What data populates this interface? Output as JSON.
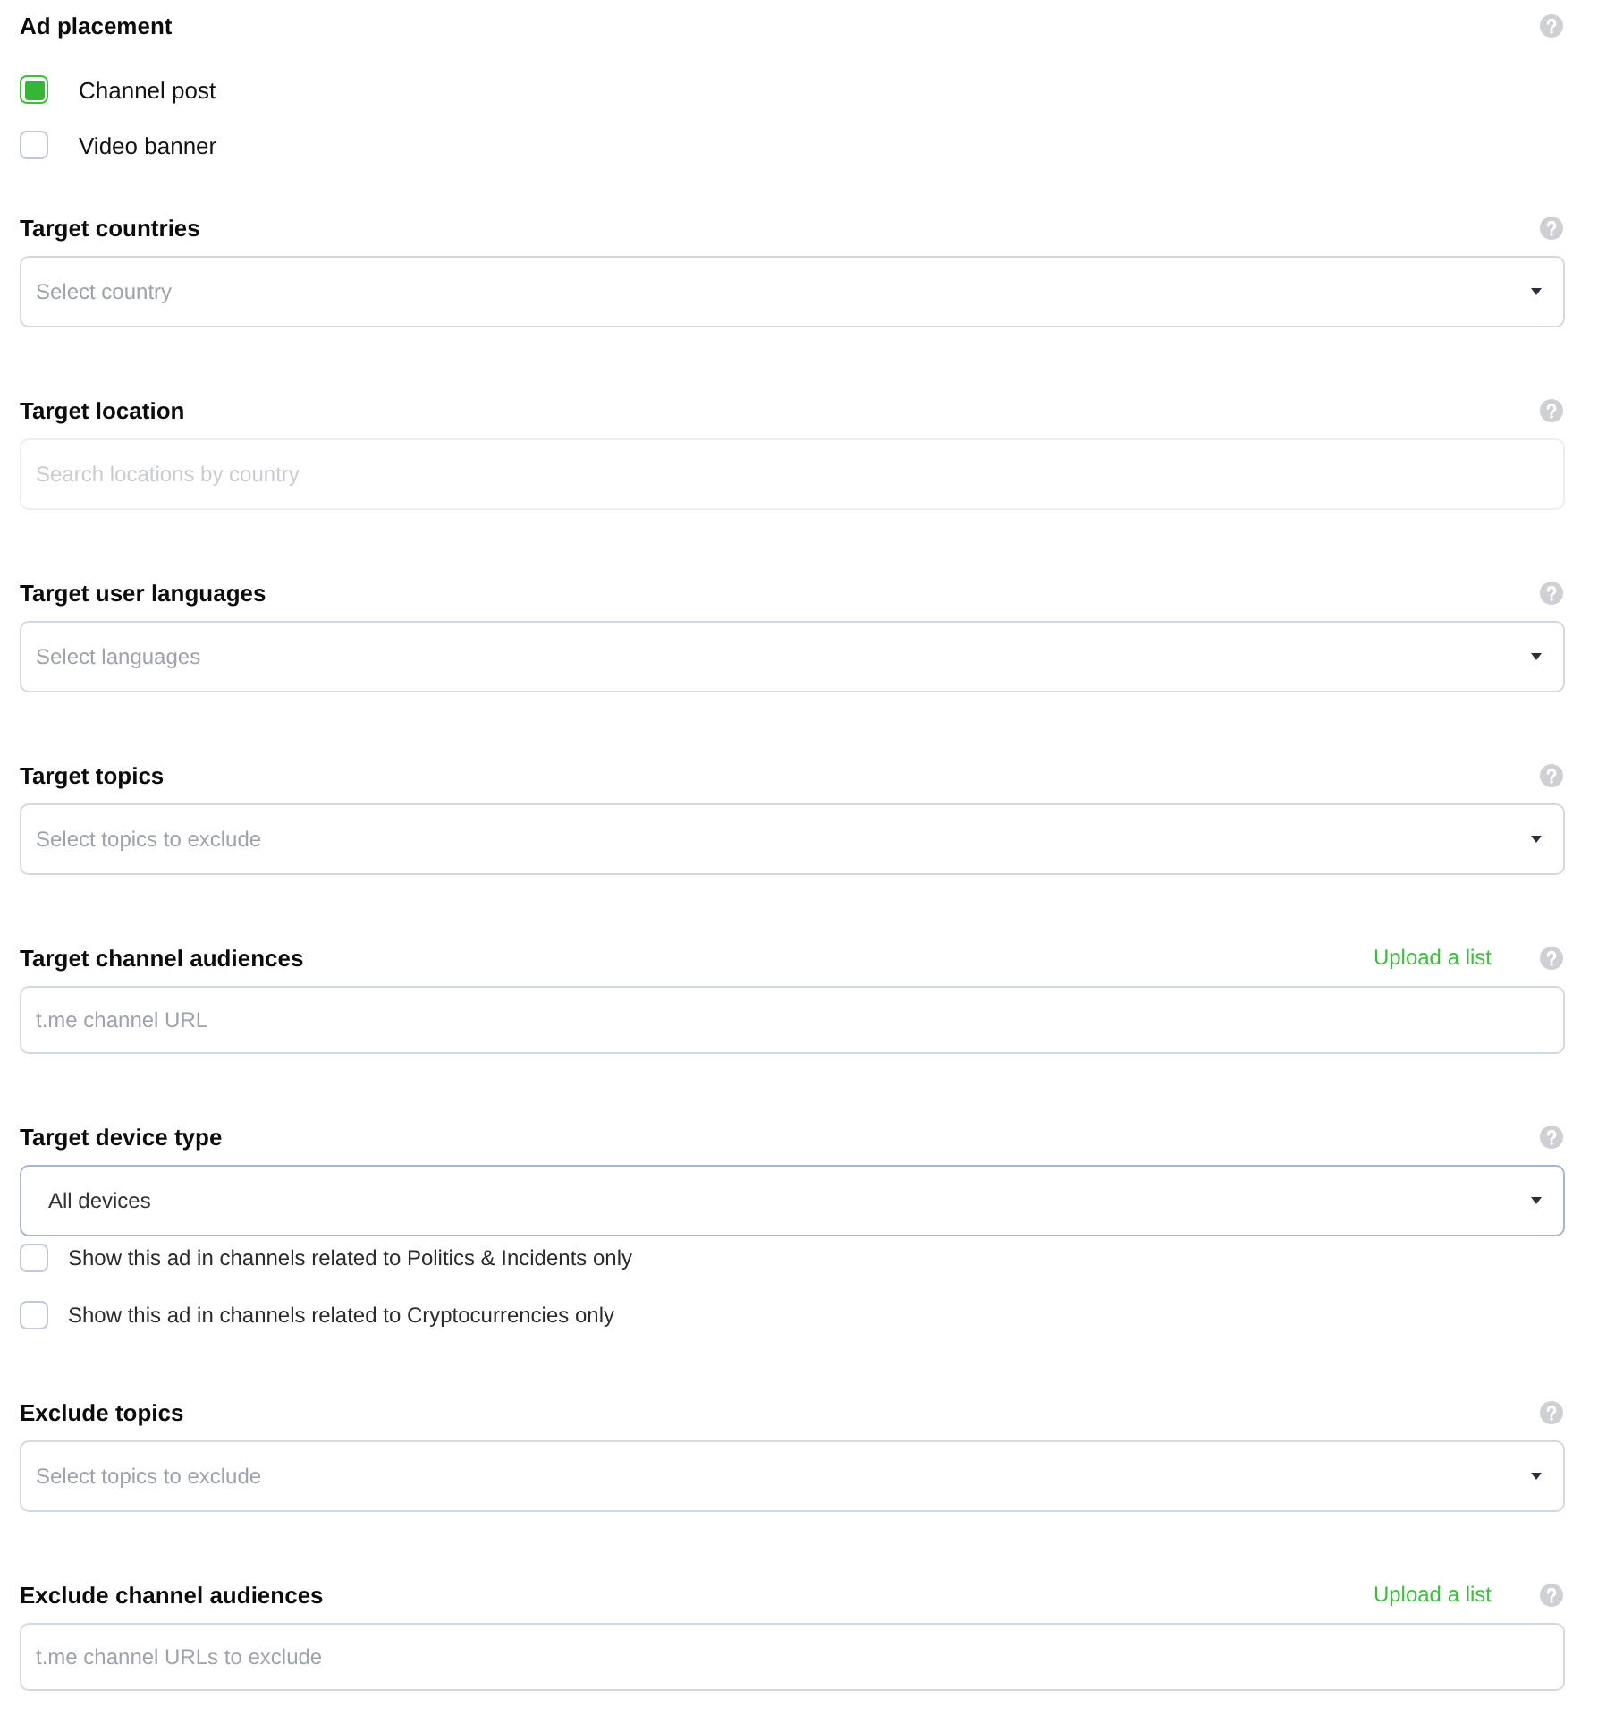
{
  "ad_placement": {
    "title": "Ad placement",
    "options": [
      {
        "label": "Channel post",
        "checked": true
      },
      {
        "label": "Video banner",
        "checked": false
      }
    ]
  },
  "fields": [
    {
      "title": "Target countries",
      "kind": "select",
      "placeholder": "Select country",
      "disabled": false,
      "focused": false
    },
    {
      "title": "Target location",
      "kind": "input",
      "placeholder": "Search locations by country",
      "disabled": true,
      "focused": false
    },
    {
      "title": "Target user languages",
      "kind": "select",
      "placeholder": "Select languages",
      "disabled": false,
      "focused": false
    },
    {
      "title": "Target topics",
      "kind": "select",
      "placeholder": "Select topics to exclude",
      "disabled": false,
      "focused": false
    },
    {
      "title": "Target channel audiences",
      "kind": "input",
      "placeholder": "t.me channel URL",
      "upload_link": "Upload a list",
      "disabled": false,
      "focused": false
    },
    {
      "title": "Target device type",
      "kind": "select",
      "value": "All devices",
      "disabled": false,
      "focused": true,
      "checkboxes": [
        {
          "label": "Show this ad in channels related to Politics & Incidents only",
          "checked": false
        },
        {
          "label": "Show this ad in channels related to Cryptocurrencies only",
          "checked": false
        }
      ]
    },
    {
      "title": "Exclude topics",
      "kind": "select",
      "placeholder": "Select topics to exclude",
      "disabled": false,
      "focused": false
    },
    {
      "title": "Exclude channel audiences",
      "kind": "input",
      "placeholder": "t.me channel URLs to exclude",
      "upload_link": "Upload a list",
      "disabled": false,
      "focused": false
    }
  ]
}
